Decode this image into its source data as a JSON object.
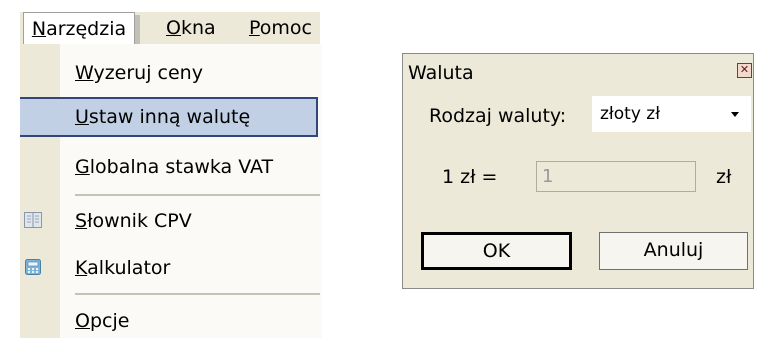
{
  "menubar": {
    "narzedzia": {
      "u": "N",
      "rest": "arzędzia"
    },
    "okna": {
      "u": "O",
      "rest": "kna"
    },
    "pomoc": {
      "u": "P",
      "rest": "omoc"
    }
  },
  "menu": {
    "wyzeruj": {
      "u": "W",
      "rest": "yzeruj ceny"
    },
    "ustaw": {
      "u": "U",
      "rest": "staw inną walutę"
    },
    "globalna": {
      "u": "G",
      "rest": "lobalna stawka VAT"
    },
    "slownik": {
      "u": "S",
      "rest": "łownik CPV"
    },
    "kalkulator": {
      "u": "K",
      "rest": "alkulator"
    },
    "opcje": {
      "u": "O",
      "rest": "pcje"
    }
  },
  "dialog": {
    "title": "Waluta",
    "rodzaj_label": "Rodzaj waluty:",
    "rodzaj_value": "złoty zł",
    "rate_label": "1 zł =",
    "rate_value": "1",
    "rate_unit": "zł",
    "ok_label": "OK",
    "cancel_label": "Anuluj"
  },
  "colors": {
    "menu_highlight": "#c1d0e4",
    "menu_highlight_border": "#34457a",
    "dialog_bg": "#ece9d8"
  }
}
